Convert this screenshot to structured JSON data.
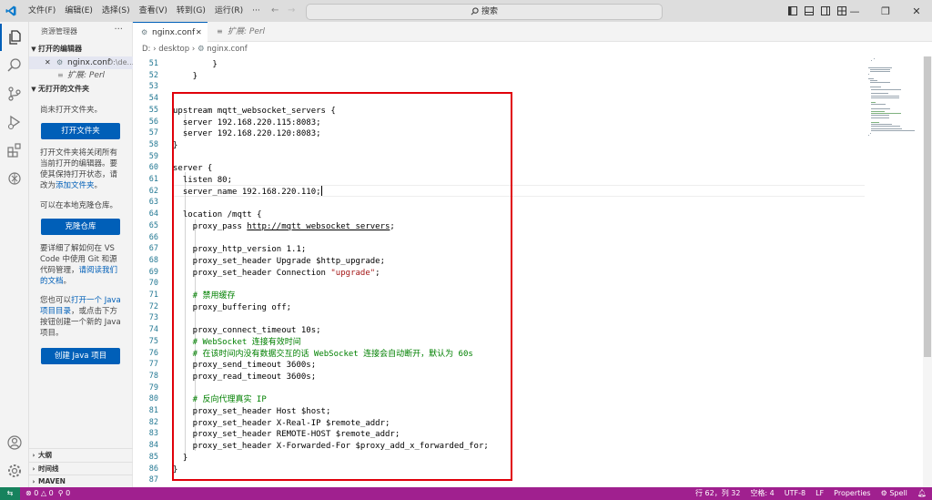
{
  "menu": [
    "文件(F)",
    "编辑(E)",
    "选择(S)",
    "查看(V)",
    "转到(G)",
    "运行(R)"
  ],
  "menu_more": "···",
  "search_placeholder": "搜索",
  "colors": {
    "accent": "#005fb8",
    "statusbar": "#a0208f",
    "remote": "#16825d",
    "highlight": "#e0000a"
  },
  "sidebar": {
    "title": "资源管理器",
    "more": "···",
    "open_editors_header": "打开的编辑器",
    "open_editor_items": [
      {
        "close": "✕",
        "name": "nginx.conf",
        "path": "D:\\de..."
      },
      {
        "name": "扩展: Perl"
      }
    ],
    "no_folder_header": "无打开的文件夹",
    "no_folder_msg": "尚未打开文件夹。",
    "open_folder_btn": "打开文件夹",
    "close_hint_prefix": "打开文件夹将关闭所有当前打开的编辑器。要使其保持打开状态，请改为",
    "add_folder_link": "添加文件夹",
    "close_hint_suffix": "。",
    "clone_hint": "可以在本地克隆仓库。",
    "clone_btn": "克隆仓库",
    "git_hint_prefix": "要详细了解如何在 VS Code 中使用 Git 和源代码管理，",
    "git_hint_link": "请阅读我们的文档",
    "git_hint_suffix": "。",
    "java_hint_prefix": "您也可以",
    "java_hint_link": "打开一个 Java 项目目录",
    "java_hint_suffix": "，或点击下方按钮创建一个新的 Java 项目。",
    "java_btn": "创建 Java 项目",
    "bottom_sections": [
      "大纲",
      "时间线",
      "MAVEN"
    ]
  },
  "tabs": [
    {
      "label": "nginx.conf",
      "active": true
    },
    {
      "label": "扩展: Perl",
      "active": false
    }
  ],
  "breadcrumb": [
    "D:",
    "desktop",
    "nginx.conf"
  ],
  "code_lines": [
    {
      "n": "51",
      "text": "        }"
    },
    {
      "n": "52",
      "text": "    }"
    },
    {
      "n": "53",
      "text": ""
    },
    {
      "n": "54",
      "text": ""
    },
    {
      "n": "55",
      "text": "upstream mqtt_websocket_servers {"
    },
    {
      "n": "56",
      "text": "  server 192.168.220.115:8083;"
    },
    {
      "n": "57",
      "text": "  server 192.168.220.120:8083;"
    },
    {
      "n": "58",
      "text": "}"
    },
    {
      "n": "59",
      "text": ""
    },
    {
      "n": "60",
      "text": "server {"
    },
    {
      "n": "61",
      "text": "  listen 80;"
    },
    {
      "n": "62",
      "text": "  server_name 192.168.220.110;"
    },
    {
      "n": "63",
      "text": ""
    },
    {
      "n": "64",
      "text": "  location /mqtt {"
    },
    {
      "n": "65",
      "text": "    proxy_pass ",
      "link": "http://mqtt_websocket_servers",
      "tail": ";"
    },
    {
      "n": "66",
      "text": ""
    },
    {
      "n": "67",
      "text": "    proxy_http_version 1.1;"
    },
    {
      "n": "68",
      "text": "    proxy_set_header Upgrade $http_upgrade;"
    },
    {
      "n": "69",
      "text": "    proxy_set_header Connection ",
      "str": "\"upgrade\"",
      "tail": ";"
    },
    {
      "n": "70",
      "text": ""
    },
    {
      "n": "71",
      "text": "    # 禁用缓存",
      "comment": true
    },
    {
      "n": "72",
      "text": "    proxy_buffering off;"
    },
    {
      "n": "73",
      "text": ""
    },
    {
      "n": "74",
      "text": "    proxy_connect_timeout 10s;"
    },
    {
      "n": "75",
      "text": "    # WebSocket 连接有效时间",
      "comment": true
    },
    {
      "n": "76",
      "text": "    # 在该时间内没有数据交互的话 WebSocket 连接会自动断开，默认为 60s",
      "comment": true
    },
    {
      "n": "77",
      "text": "    proxy_send_timeout 3600s;"
    },
    {
      "n": "78",
      "text": "    proxy_read_timeout 3600s;"
    },
    {
      "n": "79",
      "text": ""
    },
    {
      "n": "80",
      "text": "    # 反向代理真实 IP",
      "comment": true
    },
    {
      "n": "81",
      "text": "    proxy_set_header Host $host;"
    },
    {
      "n": "82",
      "text": "    proxy_set_header X-Real-IP $remote_addr;"
    },
    {
      "n": "83",
      "text": "    proxy_set_header REMOTE-HOST $remote_addr;"
    },
    {
      "n": "84",
      "text": "    proxy_set_header X-Forwarded-For $proxy_add_x_forwarded_for;"
    },
    {
      "n": "85",
      "text": "  }"
    },
    {
      "n": "86",
      "text": "}"
    },
    {
      "n": "87",
      "text": ""
    }
  ],
  "statusbar": {
    "remote": "⇆",
    "errors": "0",
    "warnings": "0",
    "ports": "0",
    "position": "行 62，列 32",
    "spaces": "空格: 4",
    "encoding": "UTF-8",
    "eol": "LF",
    "language": "Properties",
    "spell": "Spell"
  }
}
